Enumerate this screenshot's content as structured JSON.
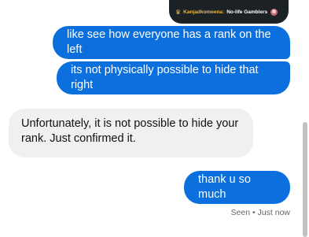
{
  "preview": {
    "crown_icon": "crown-icon",
    "handle": "Kanjadkomeena:",
    "text": "No-life Gamblers",
    "avatar_icon": "avatar-icon"
  },
  "messages": [
    {
      "side": "sent",
      "text": "like see how everyone has a rank on the left"
    },
    {
      "side": "sent",
      "text": "its not physically possible to hide that right"
    },
    {
      "side": "received",
      "text": "Unfortunately, it is not possible to hide your rank. Just confirmed it."
    },
    {
      "side": "sent",
      "text": "thank u so much"
    }
  ],
  "status": {
    "seen": "Seen • Just now"
  },
  "colors": {
    "sent_bubble": "#0b6fdd",
    "received_bubble": "#f0f0f0",
    "status_text": "#65676b"
  }
}
